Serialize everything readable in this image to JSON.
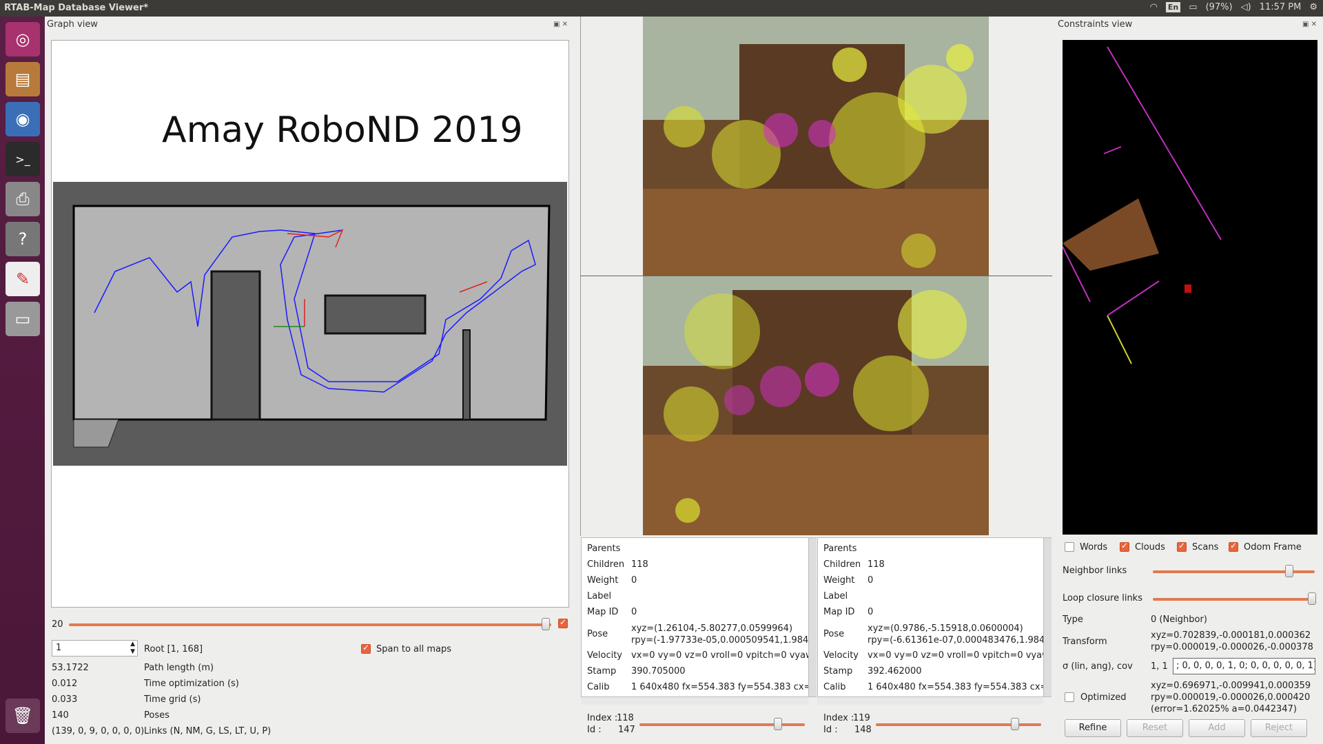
{
  "window": {
    "title": "RTAB-Map Database Viewer*"
  },
  "tray": {
    "lang": "En",
    "battery": "(97%)",
    "time": "11:57 PM"
  },
  "graph_view": {
    "title": "Graph view",
    "map_title": "Amay RoboND 2019",
    "slider_value": "20",
    "root_input": "1",
    "root_label": "Root [1, 168]",
    "span_label": "Span to all maps",
    "stats": [
      {
        "value": "53.1722",
        "label": "Path length (m)"
      },
      {
        "value": "0.012",
        "label": "Time optimization (s)"
      },
      {
        "value": "0.033",
        "label": "Time grid (s)"
      },
      {
        "value": "140",
        "label": "Poses"
      },
      {
        "value": "(139, 0, 9, 0, 0, 0, 0)",
        "label": "Links (N, NM, G, LS, LT, U, P)"
      }
    ]
  },
  "node_left": {
    "rows": [
      {
        "label": "Parents",
        "value": ""
      },
      {
        "label": "Children",
        "value": "118"
      },
      {
        "label": "Weight",
        "value": "0"
      },
      {
        "label": "Label",
        "value": ""
      },
      {
        "label": "Map ID",
        "value": "0"
      }
    ],
    "pose1": "xyz=(1.26104,-5.80277,0.0599964)",
    "pose2": "rpy=(-1.97733e-05,0.000509541,1.984",
    "velocity": "vx=0 vy=0 vz=0 vroll=0 vpitch=0 vyaw",
    "stamp": "390.705000",
    "calib": "1 640x480 fx=554.383 fy=554.383 cx=",
    "index_label": "Index :",
    "index": "118",
    "id_label": "Id :",
    "id": "147"
  },
  "node_right": {
    "rows": [
      {
        "label": "Parents",
        "value": ""
      },
      {
        "label": "Children",
        "value": "118"
      },
      {
        "label": "Weight",
        "value": "0"
      },
      {
        "label": "Label",
        "value": ""
      },
      {
        "label": "Map ID",
        "value": "0"
      }
    ],
    "pose1": "xyz=(0.9786,-5.15918,0.0600004)",
    "pose2": "rpy=(-6.61361e-07,0.000483476,1.984",
    "velocity": "vx=0 vy=0 vz=0 vroll=0 vpitch=0 vyaw",
    "stamp": "392.462000",
    "calib": "1 640x480 fx=554.383 fy=554.383 cx=",
    "index_label": "Index :",
    "index": "119",
    "id_label": "Id :",
    "id": "148"
  },
  "labels": {
    "pose": "Pose",
    "velocity": "Velocity",
    "stamp": "Stamp",
    "calib": "Calib"
  },
  "constraints": {
    "title": "Constraints view",
    "checks": [
      {
        "label": "Words",
        "checked": false
      },
      {
        "label": "Clouds",
        "checked": true
      },
      {
        "label": "Scans",
        "checked": true
      },
      {
        "label": "Odom Frame",
        "checked": true
      }
    ],
    "neighbor_links": "Neighbor links",
    "loop_links": "Loop closure links",
    "type_label": "Type",
    "type_value": "0 (Neighbor)",
    "transform_label": "Transform",
    "transform1": "xyz=0.702839,-0.000181,0.000362",
    "transform2": "rpy=0.000019,-0.000026,-0.000378",
    "sigma_label": "σ (lin, ang), cov",
    "sigma_prefix": "1, 1",
    "sigma_input": "; 0, 0, 0, 0, 1, 0;  0, 0, 0, 0, 0, 1]",
    "optimized_label": "Optimized",
    "opt1": "xyz=0.696971,-0.009941,0.000359",
    "opt2": "rpy=0.000019,-0.000026,0.000420",
    "opt3": "(error=1.62025% a=0.0442347)",
    "buttons": {
      "refine": "Refine",
      "reset": "Reset",
      "add": "Add",
      "reject": "Reject"
    }
  }
}
